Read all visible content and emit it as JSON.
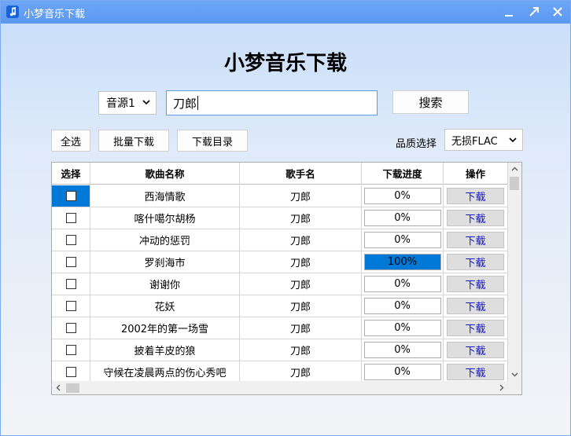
{
  "window": {
    "title": "小梦音乐下载"
  },
  "heading": "小梦音乐下载",
  "search": {
    "source_selected": "音源1",
    "query": "刀郎",
    "button_label": "搜索"
  },
  "toolbar": {
    "select_all_label": "全选",
    "batch_download_label": "批量下载",
    "download_dir_label": "下载目录",
    "quality_label": "品质选择",
    "quality_selected": "无损FLAC"
  },
  "table": {
    "columns": [
      "选择",
      "歌曲名称",
      "歌手名",
      "下载进度",
      "操作"
    ],
    "rows": [
      {
        "title": "西海情歌",
        "artist": "刀郎",
        "progress_text": "0%",
        "progress": 0,
        "action": "下载",
        "selected": true
      },
      {
        "title": "喀什噶尔胡杨",
        "artist": "刀郎",
        "progress_text": "0%",
        "progress": 0,
        "action": "下载",
        "selected": false
      },
      {
        "title": "冲动的惩罚",
        "artist": "刀郎",
        "progress_text": "0%",
        "progress": 0,
        "action": "下载",
        "selected": false
      },
      {
        "title": "罗刹海市",
        "artist": "刀郎",
        "progress_text": "100%",
        "progress": 100,
        "action": "下载",
        "selected": false
      },
      {
        "title": "谢谢你",
        "artist": "刀郎",
        "progress_text": "0%",
        "progress": 0,
        "action": "下载",
        "selected": false
      },
      {
        "title": "花妖",
        "artist": "刀郎",
        "progress_text": "0%",
        "progress": 0,
        "action": "下载",
        "selected": false
      },
      {
        "title": "2002年的第一场雪",
        "artist": "刀郎",
        "progress_text": "0%",
        "progress": 0,
        "action": "下载",
        "selected": false
      },
      {
        "title": "披着羊皮的狼",
        "artist": "刀郎",
        "progress_text": "0%",
        "progress": 0,
        "action": "下载",
        "selected": false
      },
      {
        "title": "守候在凌晨两点的伤心秀吧",
        "artist": "刀郎",
        "progress_text": "0%",
        "progress": 0,
        "action": "下载",
        "selected": false
      }
    ]
  },
  "colors": {
    "titlebar": "#5b99f2",
    "selection": "#0078d7",
    "progress_fill": "#0078d7",
    "action_text": "#1010cc"
  }
}
